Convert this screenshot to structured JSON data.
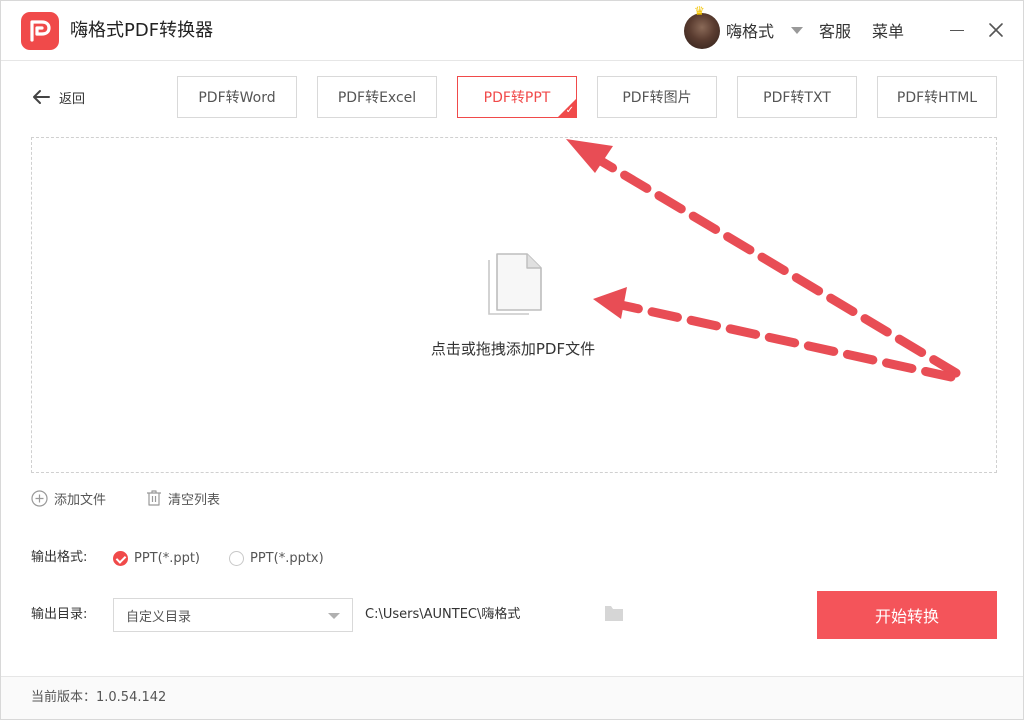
{
  "app": {
    "title": "嗨格式PDF转换器",
    "brand_color": "#f04a4a"
  },
  "header": {
    "user_name": "嗨格式",
    "service_label": "客服",
    "menu_label": "菜单"
  },
  "nav": {
    "back_label": "返回",
    "tabs": [
      {
        "label": "PDF转Word",
        "active": false
      },
      {
        "label": "PDF转Excel",
        "active": false
      },
      {
        "label": "PDF转PPT",
        "active": true
      },
      {
        "label": "PDF转图片",
        "active": false
      },
      {
        "label": "PDF转TXT",
        "active": false
      },
      {
        "label": "PDF转HTML",
        "active": false
      }
    ]
  },
  "dropzone": {
    "hint": "点击或拖拽添加PDF文件",
    "icon": "document-icon"
  },
  "file_actions": {
    "add_label": "添加文件",
    "clear_label": "清空列表"
  },
  "output": {
    "format_label": "输出格式:",
    "formats": [
      {
        "label": "PPT(*.ppt)",
        "checked": true
      },
      {
        "label": "PPT(*.pptx)",
        "checked": false
      }
    ],
    "dir_label": "输出目录:",
    "dir_select_value": "自定义目录",
    "dir_path": "C:\\Users\\AUNTEC\\嗨格式"
  },
  "actions": {
    "start_label": "开始转换",
    "start_color": "#f4545a"
  },
  "footer": {
    "version": "当前版本：1.0.54.142"
  }
}
